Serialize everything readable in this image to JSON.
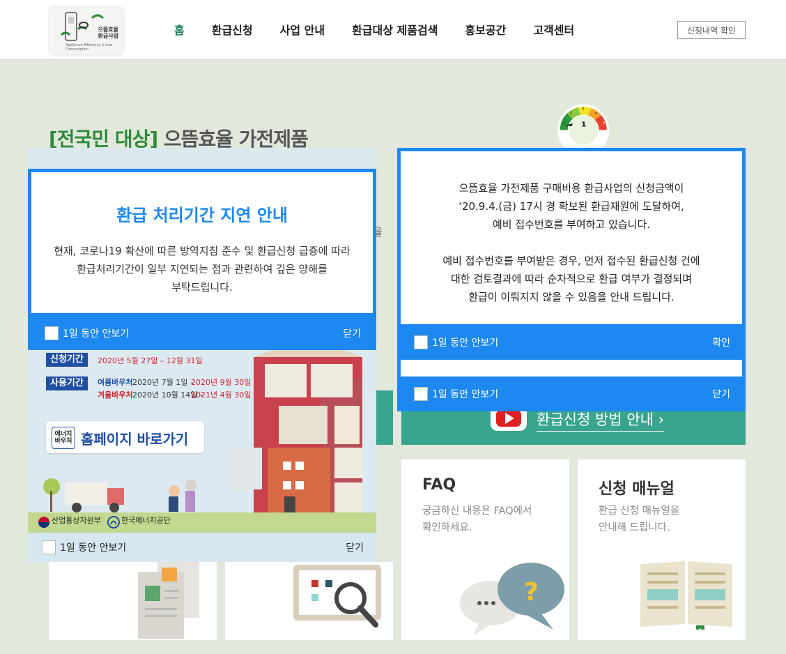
{
  "header": {
    "logo_text_line1": "으뜸효율",
    "logo_text_line2": "환급사업",
    "logo_subtext": "Appliance Efficiency & Low Consumption",
    "nav": [
      "홈",
      "환급신청",
      "사업 안내",
      "환급대상 제품검색",
      "홍보공간",
      "고객센터"
    ],
    "active_nav": "홈",
    "check_button": "신청내역 확인"
  },
  "hero": {
    "title_prefix": "[전국민 대상]",
    "title_rest": "으뜸효율 가전제품",
    "stray_text": "율"
  },
  "banners": {
    "video_text": "환급신청 방법 안내 ›"
  },
  "cards": [
    {
      "title": "FAQ",
      "desc": [
        "궁금하신 내용은 FAQ에서",
        "확인하세요."
      ]
    },
    {
      "title": "신청 매뉴얼",
      "desc": [
        "환급 신청 매뉴얼을",
        "안내해 드립니다."
      ]
    }
  ],
  "popup_delay": {
    "title": "환급 처리기간 지연 안내",
    "body": [
      "현재, 코로나19 확산에 따른 방역지침 준수 및 환급신청 급증에 따라",
      "환급처리기간이 일부 지연되는 점과 관련하여 깊은 양해를",
      "부탁드립니다."
    ],
    "dont_show": "1일 동안 안보기",
    "close": "닫기"
  },
  "popup_budget": {
    "body": [
      "으뜸효율 가전제품 구매비용 환급사업의 신청금액이",
      "‘20.9.4.(금) 17시 경 확보된 환급재원에 도달하여,",
      "예비 접수번호를 부여하고 있습니다.",
      "",
      "예비 접수번호를 부여받은 경우, 먼저 접수된 환급신청 건에",
      "대한 검토결과에 따라 순차적으로 환급 여부가 결정되며",
      "환급이 이뤄지지 않을 수 있음을 안내 드립니다."
    ],
    "dont_show_1": "1일 동안 안보기",
    "confirm": "확인",
    "dont_show_2": "1일 동안 안보기",
    "close": "닫기"
  },
  "popup_voucher": {
    "apply_label": "신청기간",
    "apply_period": "2020년 5월 27일 – 12월 31일",
    "use_label": "사용기간",
    "summer_label": "여름바우처",
    "summer_start": "2020년  7월  1일 –",
    "summer_end": "2020년 9월 30일",
    "winter_label": "겨울바우처",
    "winter_start": "2020년 10월 14일 –",
    "winter_end": "2021년 4월 30일",
    "badge_line1": "에너지",
    "badge_line2": "바우처",
    "home_button": "홈페이지 바로가기",
    "ministry": "산업통상자원부",
    "agency": "한국에너지공단",
    "dont_show": "1일 동안 안보기",
    "close": "닫기"
  },
  "gauge_labels": [
    "1",
    "2",
    "3",
    "4",
    "5"
  ],
  "gauge_center": "1",
  "colors": {
    "primary_blue": "#1c88f0",
    "teal": "#3aa58f",
    "active_green": "#1e7c5c",
    "background": "#e3e8dd"
  }
}
